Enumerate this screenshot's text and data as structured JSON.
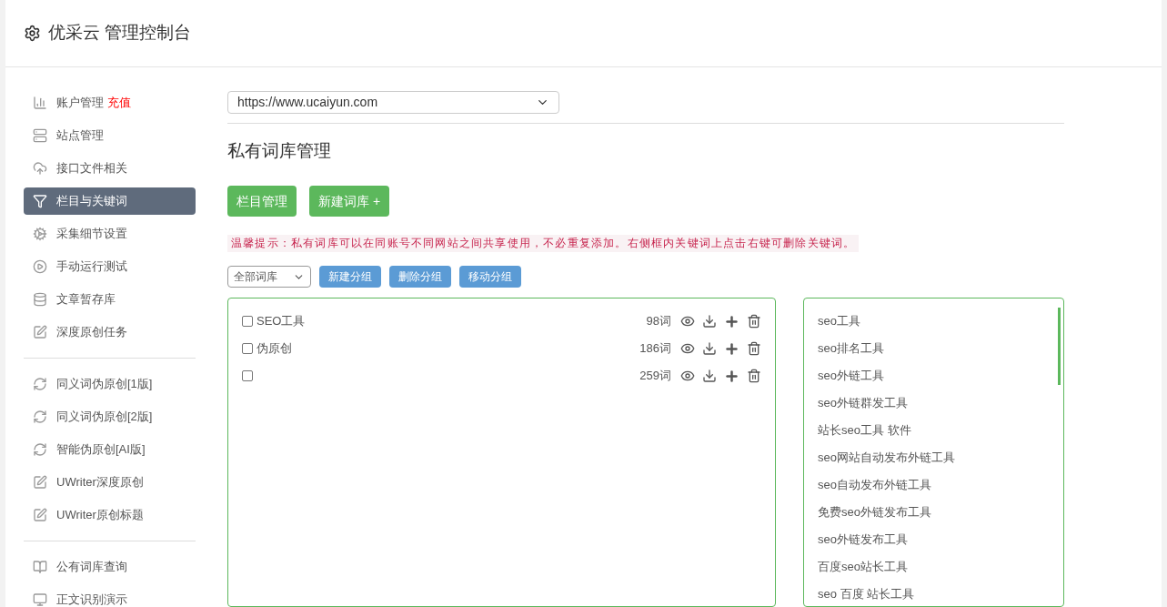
{
  "header": {
    "title": "优采云 管理控制台"
  },
  "sidebar": {
    "groups": [
      [
        {
          "label": "账户管理",
          "badge": "充值",
          "selected": false
        },
        {
          "label": "站点管理",
          "selected": false
        },
        {
          "label": "接口文件相关",
          "selected": false
        },
        {
          "label": "栏目与关键词",
          "selected": true
        },
        {
          "label": "采集细节设置",
          "selected": false
        },
        {
          "label": "手动运行测试",
          "selected": false
        },
        {
          "label": "文章暂存库",
          "selected": false
        },
        {
          "label": "深度原创任务",
          "selected": false
        }
      ],
      [
        {
          "label": "同义词伪原创[1版]",
          "selected": false
        },
        {
          "label": "同义词伪原创[2版]",
          "selected": false
        },
        {
          "label": "智能伪原创[AI版]",
          "selected": false
        },
        {
          "label": "UWriter深度原创",
          "selected": false
        },
        {
          "label": "UWriter原创标题",
          "selected": false
        }
      ],
      [
        {
          "label": "公有词库查询",
          "selected": false
        },
        {
          "label": "正文识别演示",
          "selected": false
        }
      ]
    ]
  },
  "site_select": {
    "value": "https://www.ucaiyun.com"
  },
  "page_title": "私有词库管理",
  "buttons": [
    "栏目管理",
    "新建词库 +"
  ],
  "tip": "温馨提示：私有词库可以在同账号不同网站之间共享使用，不必重复添加。右侧框内关键词上点击右键可删除关键词。",
  "filter_select": {
    "value": "全部词库"
  },
  "group_buttons": [
    "新建分组",
    "删除分组",
    "移动分组"
  ],
  "libraries": [
    {
      "label": "SEO工具",
      "count": "98词",
      "checked": false
    },
    {
      "label": "伪原创",
      "count": "186词",
      "checked": false
    },
    {
      "count": "259词",
      "checked": false
    }
  ],
  "keywords": [
    "seo工具",
    "seo排名工具",
    "seo外链工具",
    "seo外链群发工具",
    "站长seo工具 软件",
    "seo网站自动发布外链工具",
    "seo自动发布外链工具",
    "免费seo外链发布工具",
    "seo外链发布工具",
    "百度seo站长工具",
    "seo 百度 站长工具"
  ]
}
